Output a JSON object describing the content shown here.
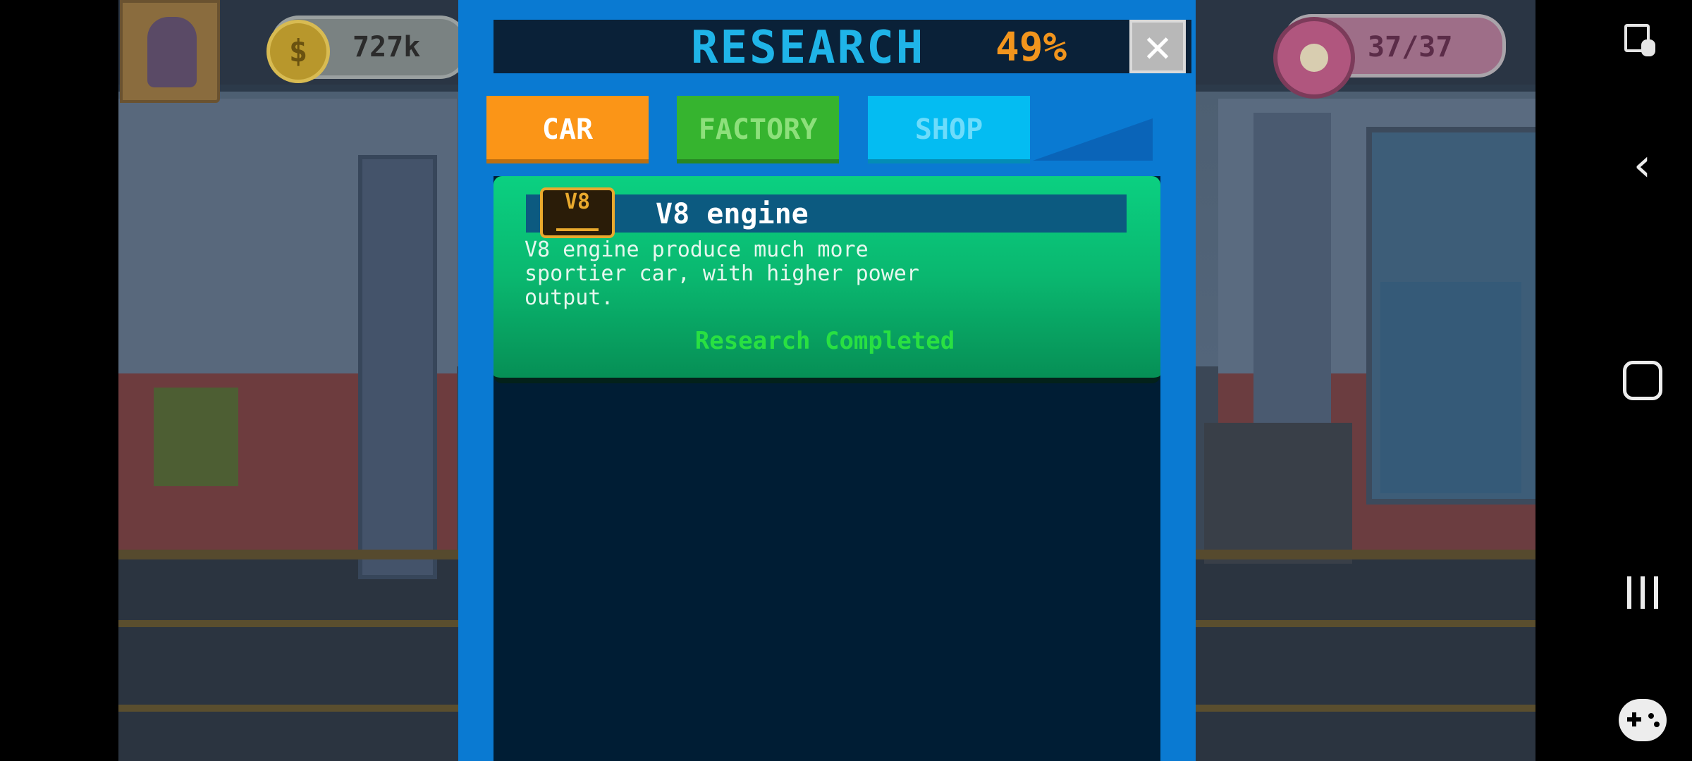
{
  "hud": {
    "money": "727k",
    "money_icon": "dollar-coin-icon",
    "donuts": "37/37",
    "donut_icon": "donut-icon"
  },
  "research_panel": {
    "title": "RESEARCH",
    "progress": "49%",
    "close_icon": "close-icon",
    "tabs": [
      {
        "label": "CAR",
        "color": "#fb9517",
        "selected": true
      },
      {
        "label": "FACTORY",
        "color": "#36b42f",
        "selected": false
      },
      {
        "label": "SHOP",
        "color": "#04bcf2",
        "selected": false
      }
    ],
    "items": [
      {
        "icon_text": "V8",
        "title": "V8 engine",
        "description": "V8 engine produce much more\nsportier car, with higher power\noutput.",
        "status": "Research Completed"
      }
    ]
  },
  "system_nav": {
    "icons": [
      "screen-lock-icon",
      "back-icon",
      "home-icon",
      "recent-apps-icon",
      "game-launcher-icon"
    ]
  },
  "colors": {
    "panel_bg": "#0a7ad2",
    "header_bg": "#0a2138",
    "title_color": "#1fb4e8",
    "progress_color": "#f2951d",
    "card_green": "#0bd081",
    "status_green": "#29e042"
  }
}
